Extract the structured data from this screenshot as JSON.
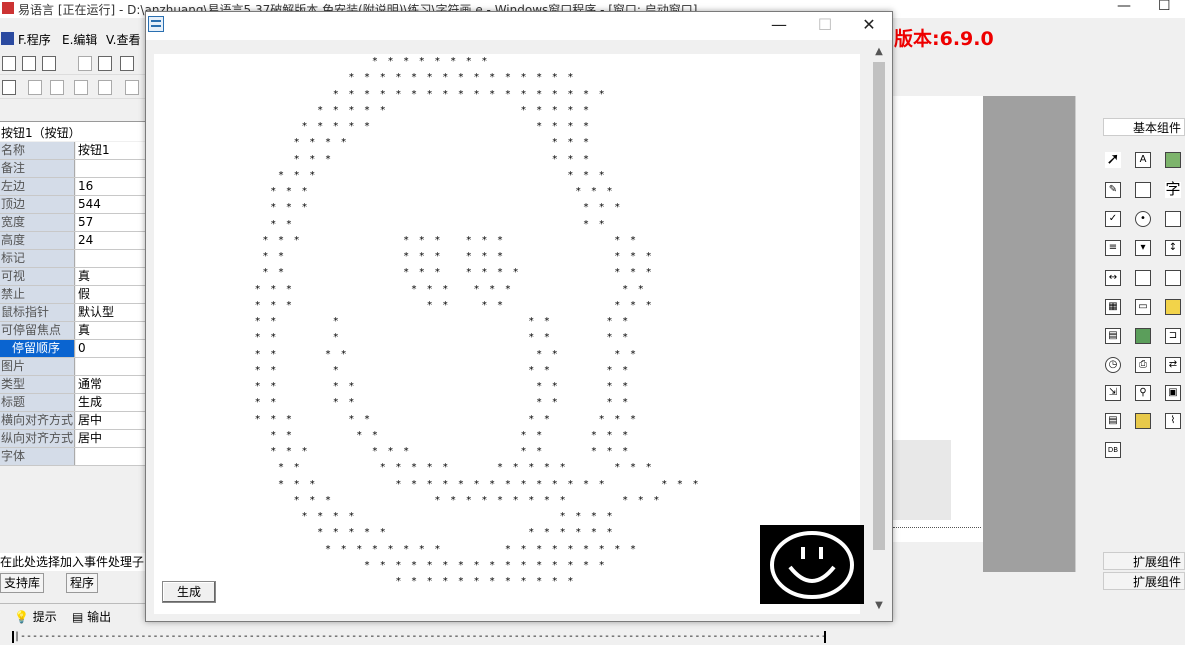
{
  "ide": {
    "title": "易语言 [正在运行] - D:\\anzhuang\\易语言5.37破解版本 免安装(附说明)\\练习\\字符画.e - Windows窗口程序 - [窗口: 启动窗口]",
    "version_label": "版本:6.9.0",
    "menu": [
      "F.程序",
      "E.编辑",
      "V.查看"
    ]
  },
  "properties": {
    "header": "按钮1（按钮）",
    "rows": [
      {
        "name": "名称",
        "value": "按钮1"
      },
      {
        "name": "备注",
        "value": ""
      },
      {
        "name": "左边",
        "value": "16"
      },
      {
        "name": "顶边",
        "value": "544"
      },
      {
        "name": "宽度",
        "value": "57"
      },
      {
        "name": "高度",
        "value": "24"
      },
      {
        "name": "标记",
        "value": ""
      },
      {
        "name": "可视",
        "value": "真"
      },
      {
        "name": "禁止",
        "value": "假"
      },
      {
        "name": "鼠标指针",
        "value": "默认型"
      },
      {
        "name": "可停留焦点",
        "value": "真"
      },
      {
        "name": "停留顺序",
        "value": "0"
      },
      {
        "name": "图片",
        "value": ""
      },
      {
        "name": "类型",
        "value": "通常"
      },
      {
        "name": "标题",
        "value": "生成"
      },
      {
        "name": "横向对齐方式",
        "value": "居中"
      },
      {
        "name": "纵向对齐方式",
        "value": "居中"
      },
      {
        "name": "字体",
        "value": ""
      }
    ],
    "event_hint": "在此处选择加入事件处理子",
    "tabs": [
      "支持库",
      "程序"
    ],
    "bottom_tabs": [
      "提示",
      "输出"
    ]
  },
  "components": {
    "header": "基本组件",
    "ext1": "扩展组件",
    "ext2": "扩展组件",
    "icons": [
      "pointer-icon",
      "label-icon",
      "picture-box-icon",
      "edit-icon",
      "button-icon",
      "text-icon",
      "checkbox-icon",
      "radio-icon",
      "group-icon",
      "list-icon",
      "combo-icon",
      "scrollbar-icon",
      "hscroll-icon",
      "tab-icon",
      "progress-icon",
      "grid-icon",
      "textbox-icon",
      "file-box-icon",
      "tree-icon",
      "network-icon",
      "frame-icon",
      "timer-icon",
      "printer-icon",
      "transfer-icon",
      "drive-icon",
      "connect-icon",
      "window-icon",
      "data-icon",
      "db-icon",
      "chart-icon",
      "odbc-icon"
    ]
  },
  "popup": {
    "art": "                       * * * * * * * *\n                    * * * * * * * * * * * * * * *\n                  * * * * * * * * * * * * * * * * * *\n                * * * * *                 * * * * *\n              * * * * *                     * * * *\n             * * * *                          * * *\n             * * *                            * * *\n           * * *                                * * *\n          * * *                                  * * *\n          * * *                                   * * *\n          * *                                     * *\n         * * *             * * *   * * *              * *\n         * *               * * *   * * *              * * *\n         * *               * * *   * * * *            * * *\n        * * *               * * *   * * *              * *\n        * * *                 * *    * *              * * *\n        * *       *                        * *       * *\n        * *       *                        * *       * *\n        * *      * *                        * *       * *\n        * *       *                        * *       * *\n        * *       * *                       * *      * *\n        * *       * *                       * *      * *\n        * * *       * *                    * *      * * *\n          * *        * *                  * *      * * *\n          * * *        * * *              * *      * * *\n           * *          * * * * *      * * * * *      * * *\n           * * *          * * * * * * * * * * * * * *       * * *\n             * * *             * * * * * * * * *       * * *\n              * * * *                          * * * *\n                * * * * *                  * * * * * *\n                 * * * * * * * *        * * * * * * * * *\n                      * * * * * * * * * * * * * * * *\n                          * * * * * * * * * * * *",
    "button_label": "生成"
  },
  "ruler": "|------------------------------------------------------------------------------------------------------------------------------------------|"
}
